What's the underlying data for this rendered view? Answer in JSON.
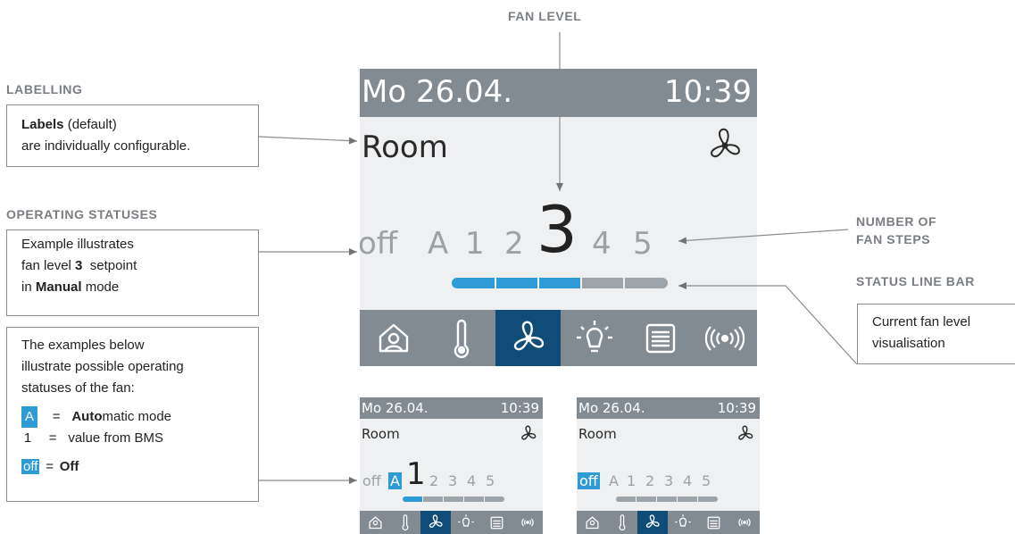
{
  "headings": {
    "fan_level": "FAN LEVEL",
    "labelling": "LABELLING",
    "operating_statuses": "OPERATING STATUSES",
    "number_of_fan_steps_line1": "NUMBER OF",
    "number_of_fan_steps_line2": "FAN STEPS",
    "status_line_bar": "STATUS LINE BAR"
  },
  "notes": {
    "labels_bold": "Labels",
    "labels_default": " (default)",
    "labels_line2": "are individually configurable.",
    "example_line1": "Example illustrates",
    "example_line2_pre": "fan level ",
    "example_line2_bold": "3",
    "example_line2_post": "  setpoint",
    "example_line3_pre": "in ",
    "example_line3_bold": "Manual",
    "example_line3_post": " mode",
    "below_line1": "The examples below",
    "below_line2": "illustrate possible operating",
    "below_line3": "statuses of the fan:",
    "legend_a_key": "A",
    "legend_a_eq": "=",
    "legend_a_bold": "Auto",
    "legend_a_rest": "matic mode",
    "legend_1_key": "1",
    "legend_1_eq": "=",
    "legend_1_text": "value from BMS",
    "legend_off_key": "off",
    "legend_off_eq": "=",
    "legend_off_text": "Off",
    "current_line1": "Current fan level",
    "current_line2": "visualisation"
  },
  "device": {
    "date": "Mo 26.04.",
    "time": "10:39",
    "room": "Room",
    "levels": [
      "off",
      "A",
      "1",
      "2",
      "3",
      "4",
      "5"
    ],
    "selected_level": "3",
    "segments_on": 3,
    "segments_total": 5,
    "nav_icons": [
      "home-person-icon",
      "thermometer-icon",
      "fan-icon",
      "lightbulb-icon",
      "blinds-icon",
      "wireless-icon"
    ],
    "active_nav": "fan-icon"
  },
  "example_auto": {
    "date": "Mo 26.04.",
    "time": "10:39",
    "room": "Room",
    "levels": [
      "off",
      "A",
      "1",
      "2",
      "3",
      "4",
      "5"
    ],
    "highlight": "A",
    "big_level": "1",
    "segments_on": 1,
    "segments_total": 5
  },
  "example_off": {
    "date": "Mo 26.04.",
    "time": "10:39",
    "room": "Room",
    "levels": [
      "off",
      "A",
      "1",
      "2",
      "3",
      "4",
      "5"
    ],
    "highlight": "off",
    "segments_on": 0,
    "segments_total": 5
  },
  "colors": {
    "highlight_blue": "#2e9ad6",
    "active_nav": "#0f4d78",
    "bar_grey": "#838b92",
    "screen_bg": "#eef0f1"
  }
}
